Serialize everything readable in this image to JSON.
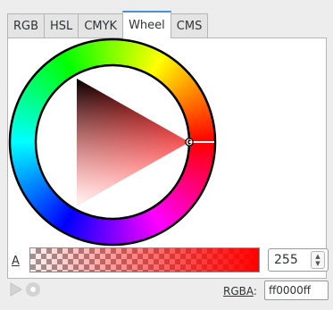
{
  "tabs": [
    {
      "label": "RGB",
      "active": false
    },
    {
      "label": "HSL",
      "active": false
    },
    {
      "label": "CMYK",
      "active": false
    },
    {
      "label": "Wheel",
      "active": true
    },
    {
      "label": "CMS",
      "active": false
    }
  ],
  "color": {
    "hex": "#ff0000",
    "hue_degrees": 0
  },
  "alpha": {
    "label_mnemonic": "A",
    "value": "255"
  },
  "rgba": {
    "label": "RGBA",
    "label_suffix": ":",
    "value": "ff0000ff"
  },
  "icons": {
    "color_managed": "color-managed-triangle-icon",
    "out_of_gamut": "out-of-gamut-circle-icon",
    "spin_up": "▲",
    "spin_down": "▼"
  }
}
